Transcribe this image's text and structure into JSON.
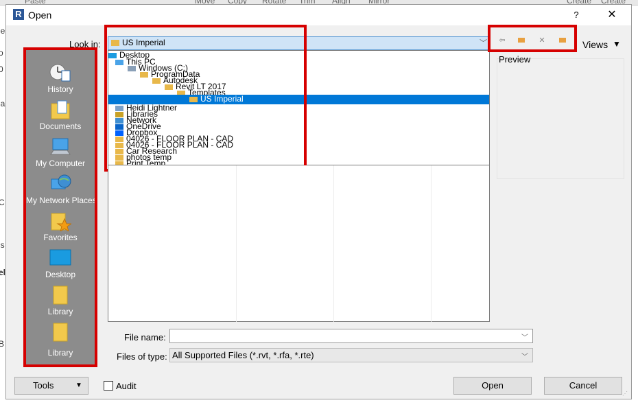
{
  "background": {
    "ribbon": [
      "Paste",
      "Move",
      "Copy",
      "Rotate",
      "Trim",
      "Align",
      "Mirror",
      "Create",
      "Create"
    ],
    "left_letters": [
      "ie",
      "o",
      "0",
      "la",
      "l",
      "l",
      "l",
      "l",
      "C",
      "ls",
      "l",
      "el",
      "B"
    ]
  },
  "dialog": {
    "title": "Open",
    "logo": "R",
    "help": "?",
    "close": "✕"
  },
  "places": [
    {
      "label": "History",
      "icon": "history-icon"
    },
    {
      "label": "Documents",
      "icon": "documents-folder-icon"
    },
    {
      "label": "My Computer",
      "icon": "computer-icon"
    },
    {
      "label": "My Network Places",
      "icon": "network-globe-icon"
    },
    {
      "label": "Favorites",
      "icon": "favorites-folder-icon"
    },
    {
      "label": "Desktop",
      "icon": "desktop-icon"
    },
    {
      "label": "Library",
      "icon": "folder-icon"
    },
    {
      "label": "Library",
      "icon": "folder-icon"
    }
  ],
  "lookin": {
    "label": "Look in:",
    "value": "US Imperial"
  },
  "tree": [
    {
      "label": "Desktop",
      "indent": 0
    },
    {
      "label": "This PC",
      "indent": 1
    },
    {
      "label": "Windows (C:)",
      "indent": 2
    },
    {
      "label": "ProgramData",
      "indent": 3
    },
    {
      "label": "Autodesk",
      "indent": 4
    },
    {
      "label": "Revit LT 2017",
      "indent": 5
    },
    {
      "label": "Templates",
      "indent": 6
    },
    {
      "label": "US Imperial",
      "indent": 7,
      "selected": true
    },
    {
      "label": "Heidi Lightner",
      "indent": 1
    },
    {
      "label": "Libraries",
      "indent": 1
    },
    {
      "label": "Network",
      "indent": 1
    },
    {
      "label": "OneDrive",
      "indent": 1
    },
    {
      "label": "Dropbox",
      "indent": 1
    },
    {
      "label": "04026 - FLOOR PLAN - CAD",
      "indent": 1
    },
    {
      "label": "04026 - FLOOR PLAN - CAD",
      "indent": 1
    },
    {
      "label": "Car Research",
      "indent": 1
    },
    {
      "label": "photos temp",
      "indent": 1
    },
    {
      "label": "Print Temp",
      "indent": 1
    }
  ],
  "toolbar": {
    "back_icon": "back-arrow-icon",
    "up_icon": "up-folder-icon",
    "delete": "✕",
    "new_folder_icon": "new-folder-icon",
    "views_label": "Views"
  },
  "preview": {
    "label": "Preview"
  },
  "file_name": {
    "label": "File name:",
    "value": ""
  },
  "file_type": {
    "label": "Files of type:",
    "value": "All Supported Files  (*.rvt, *.rfa, *.rte)"
  },
  "buttons": {
    "tools": "Tools",
    "audit": "Audit",
    "open": "Open",
    "cancel": "Cancel"
  },
  "colors": {
    "highlight": "#d60000",
    "selection": "#0078d7",
    "sidebar": "#8c8c8c"
  }
}
